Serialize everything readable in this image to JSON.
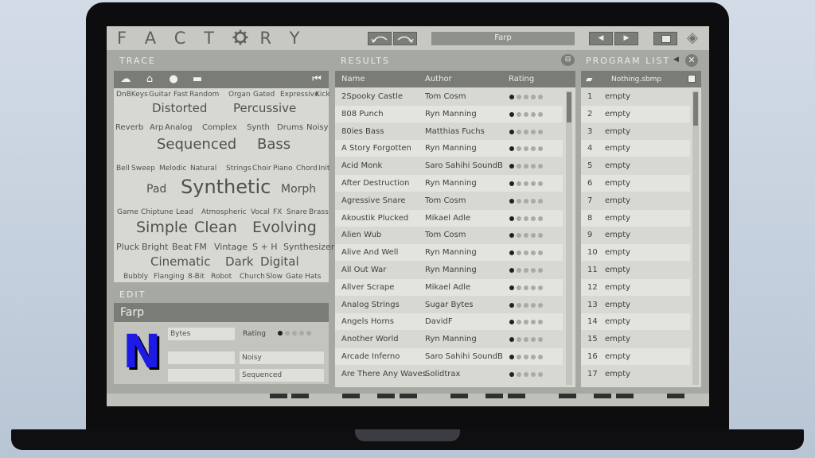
{
  "app": {
    "title": "FACTORY",
    "preset_name": "Farp"
  },
  "sections": {
    "trace": "TRACE",
    "results": "RESULTS",
    "program_list": "PROGRAM LIST",
    "edit": "EDIT"
  },
  "trace_tags": [
    {
      "t": "DnBKeys",
      "s": 9
    },
    {
      "t": "Guitar",
      "s": 9
    },
    {
      "t": "Fast",
      "s": 9
    },
    {
      "t": "Random",
      "s": 9
    },
    {
      "t": "Organ",
      "s": 9
    },
    {
      "t": "Gated",
      "s": 9
    },
    {
      "t": "Expressive",
      "s": 9
    },
    {
      "t": "Kick",
      "s": 9
    },
    {
      "t": "Distorted",
      "s": 15
    },
    {
      "t": "Percussive",
      "s": 15
    },
    {
      "t": "Reverb",
      "s": 10
    },
    {
      "t": "Arp",
      "s": 10
    },
    {
      "t": "Analog",
      "s": 10
    },
    {
      "t": "Complex",
      "s": 10
    },
    {
      "t": "Synth",
      "s": 10
    },
    {
      "t": "Drums",
      "s": 10
    },
    {
      "t": "Noisy",
      "s": 10
    },
    {
      "t": "Sequenced",
      "s": 18
    },
    {
      "t": "Bass",
      "s": 18
    },
    {
      "t": "Bell",
      "s": 9
    },
    {
      "t": "Sweep",
      "s": 9
    },
    {
      "t": "Melodic",
      "s": 9
    },
    {
      "t": "Natural",
      "s": 9
    },
    {
      "t": "Strings",
      "s": 9
    },
    {
      "t": "Choir",
      "s": 9
    },
    {
      "t": "Piano",
      "s": 9
    },
    {
      "t": "Chord",
      "s": 9
    },
    {
      "t": "Init",
      "s": 9
    },
    {
      "t": "Pad",
      "s": 14
    },
    {
      "t": "Synthetic",
      "s": 24
    },
    {
      "t": "Morph",
      "s": 14
    },
    {
      "t": "Game",
      "s": 9
    },
    {
      "t": "Chiptune",
      "s": 9
    },
    {
      "t": "Lead",
      "s": 9
    },
    {
      "t": "Atmospheric",
      "s": 9
    },
    {
      "t": "Vocal",
      "s": 9
    },
    {
      "t": "FX",
      "s": 9
    },
    {
      "t": "Snare",
      "s": 9
    },
    {
      "t": "Brass",
      "s": 9
    },
    {
      "t": "Simple",
      "s": 19
    },
    {
      "t": "Clean",
      "s": 19
    },
    {
      "t": "Evolving",
      "s": 19
    },
    {
      "t": "Pluck",
      "s": 11
    },
    {
      "t": "Bright",
      "s": 11
    },
    {
      "t": "Beat",
      "s": 11
    },
    {
      "t": "FM",
      "s": 11
    },
    {
      "t": "Vintage",
      "s": 11
    },
    {
      "t": "S + H",
      "s": 11
    },
    {
      "t": "Synthesizer",
      "s": 11
    },
    {
      "t": "Cinematic",
      "s": 15
    },
    {
      "t": "Dark",
      "s": 15
    },
    {
      "t": "Digital",
      "s": 15
    },
    {
      "t": "Bubbly",
      "s": 9
    },
    {
      "t": "Flanging",
      "s": 9
    },
    {
      "t": "8-Bit",
      "s": 9
    },
    {
      "t": "Robot",
      "s": 9
    },
    {
      "t": "Church",
      "s": 9
    },
    {
      "t": "Slow",
      "s": 9
    },
    {
      "t": "Gate",
      "s": 9
    },
    {
      "t": "Hats",
      "s": 9
    }
  ],
  "results": {
    "columns": [
      "Name",
      "Author",
      "Rating"
    ],
    "rows": [
      {
        "name": "2Spooky Castle",
        "author": "Tom Cosm",
        "rating": 1
      },
      {
        "name": "808 Punch",
        "author": "Ryn Manning",
        "rating": 1
      },
      {
        "name": "80ies Bass",
        "author": "Matthias Fuchs",
        "rating": 1
      },
      {
        "name": "A Story Forgotten",
        "author": "Ryn Manning",
        "rating": 1
      },
      {
        "name": "Acid Monk",
        "author": "Saro Sahihi SoundB...",
        "rating": 1
      },
      {
        "name": "After Destruction",
        "author": "Ryn Manning",
        "rating": 1
      },
      {
        "name": "Agressive Snare",
        "author": "Tom Cosm",
        "rating": 1
      },
      {
        "name": "Akoustik Plucked",
        "author": "Mikael Adle",
        "rating": 1
      },
      {
        "name": "Alien Wub",
        "author": "Tom Cosm",
        "rating": 1
      },
      {
        "name": "Alive And Well",
        "author": "Ryn Manning",
        "rating": 1
      },
      {
        "name": "All Out War",
        "author": "Ryn Manning",
        "rating": 1
      },
      {
        "name": "Allver Scrape",
        "author": "Mikael Adle",
        "rating": 1
      },
      {
        "name": "Analog Strings",
        "author": "Sugar Bytes",
        "rating": 1
      },
      {
        "name": "Angels Horns",
        "author": "DavidF",
        "rating": 1
      },
      {
        "name": "Another World",
        "author": "Ryn Manning",
        "rating": 1
      },
      {
        "name": "Arcade Inferno",
        "author": "Saro Sahihi SoundB...",
        "rating": 1
      },
      {
        "name": "Are There Any Waves",
        "author": "Solidtrax",
        "rating": 1
      }
    ]
  },
  "program_list": {
    "file": "Nothing.sbmp",
    "rows": [
      {
        "num": "1",
        "name": "empty"
      },
      {
        "num": "2",
        "name": "empty"
      },
      {
        "num": "3",
        "name": "empty"
      },
      {
        "num": "4",
        "name": "empty"
      },
      {
        "num": "5",
        "name": "empty"
      },
      {
        "num": "6",
        "name": "empty"
      },
      {
        "num": "7",
        "name": "empty"
      },
      {
        "num": "8",
        "name": "empty"
      },
      {
        "num": "9",
        "name": "empty"
      },
      {
        "num": "10",
        "name": "empty"
      },
      {
        "num": "11",
        "name": "empty"
      },
      {
        "num": "12",
        "name": "empty"
      },
      {
        "num": "13",
        "name": "empty"
      },
      {
        "num": "14",
        "name": "empty"
      },
      {
        "num": "15",
        "name": "empty"
      },
      {
        "num": "16",
        "name": "empty"
      },
      {
        "num": "17",
        "name": "empty"
      }
    ]
  },
  "edit": {
    "name": "Farp",
    "author_partial": "Bytes",
    "rating_label": "Rating",
    "rating": 1,
    "tag1": "Noisy",
    "tag2": "Sequenced"
  },
  "overlay_logo": "N",
  "icons": {
    "undo": "undo-arrow-icon",
    "redo": "redo-arrow-icon",
    "prev": "prev-triangle-icon",
    "next": "next-triangle-icon"
  },
  "colors": {
    "panel": "#d7d8d2",
    "header_bar": "#7a7d77",
    "logo_blue": "#1d1ae6"
  }
}
